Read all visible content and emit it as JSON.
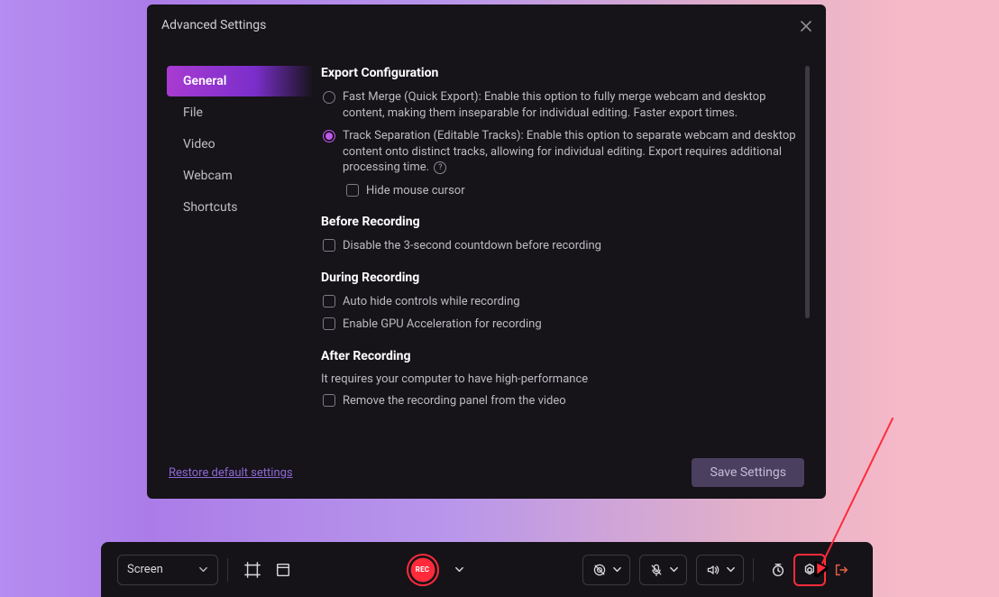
{
  "dialog": {
    "title": "Advanced Settings",
    "sidebar": {
      "items": [
        {
          "label": "General"
        },
        {
          "label": "File"
        },
        {
          "label": "Video"
        },
        {
          "label": "Webcam"
        },
        {
          "label": "Shortcuts"
        }
      ]
    },
    "sections": {
      "export_config": {
        "title": "Export Configuration",
        "fast_merge": "Fast Merge (Quick Export): Enable this option to fully merge webcam and desktop content, making them inseparable for individual editing. Faster export times.",
        "track_sep": "Track Separation (Editable Tracks): Enable this option to separate webcam and desktop content onto distinct tracks, allowing for individual editing. Export requires additional processing time.",
        "hide_cursor": "Hide mouse cursor"
      },
      "before_recording": {
        "title": "Before Recording",
        "disable_countdown": "Disable the 3-second countdown before recording"
      },
      "during_recording": {
        "title": "During Recording",
        "auto_hide": "Auto hide controls while recording",
        "gpu_accel": "Enable GPU Acceleration for recording"
      },
      "after_recording": {
        "title": "After Recording",
        "subtext": "It requires your computer to have high-performance",
        "remove_panel": "Remove the recording panel from the video"
      }
    },
    "footer": {
      "restore": "Restore default settings",
      "save": "Save Settings"
    }
  },
  "panel": {
    "screen_label": "Screen",
    "rec_label": "REC"
  }
}
